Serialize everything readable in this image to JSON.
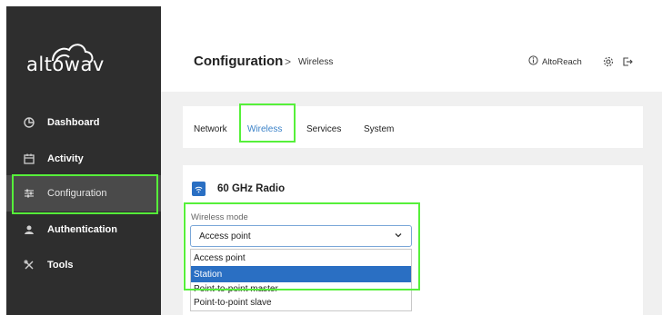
{
  "brand": {
    "logo_text": "altowav"
  },
  "sidebar": {
    "items": [
      {
        "label": "Dashboard",
        "icon": "pie-chart-icon"
      },
      {
        "label": "Activity",
        "icon": "calendar-icon"
      },
      {
        "label": "Configuration",
        "icon": "sliders-icon"
      },
      {
        "label": "Authentication",
        "icon": "user-shield-icon"
      },
      {
        "label": "Tools",
        "icon": "tools-icon"
      }
    ],
    "active": "Configuration"
  },
  "header": {
    "title": "Configuration",
    "separator": ">",
    "breadcrumb": "Wireless",
    "user": "AltoReach",
    "icons": [
      "info-icon",
      "gear-icon",
      "logout-icon"
    ]
  },
  "tabs": [
    {
      "label": "Network"
    },
    {
      "label": "Wireless"
    },
    {
      "label": "Services"
    },
    {
      "label": "System"
    }
  ],
  "active_tab": "Wireless",
  "radio": {
    "title": "60 GHz Radio",
    "icon": "wifi-icon",
    "field_label": "Wireless mode",
    "selected": "Access point",
    "options": [
      "Access point",
      "Station",
      "Point-to-point master",
      "Point-to-point slave"
    ],
    "highlighted_option": "Station"
  },
  "colors": {
    "accent": "#3b82c8",
    "sidebar": "#2e2e2e",
    "highlight": "#56f03a",
    "selected_option": "#2a6fc3"
  }
}
